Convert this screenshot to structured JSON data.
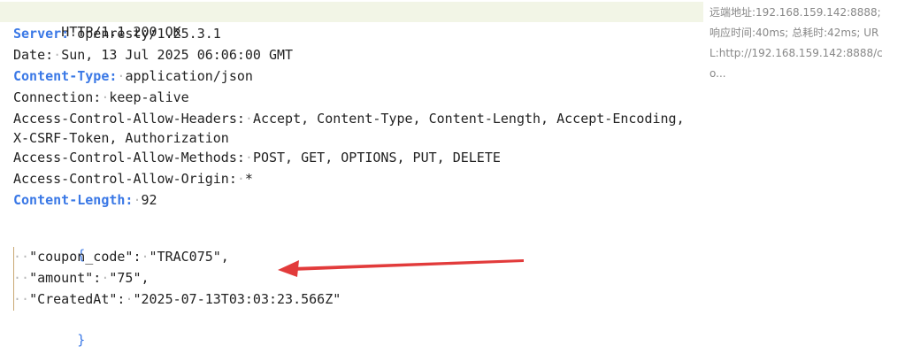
{
  "status_line": "HTTP/1.1 200 OK",
  "headers": [
    {
      "name": "Server:",
      "value": "openresty/1.25.3.1",
      "highlight": true
    },
    {
      "name": "Date:",
      "value": "Sun, 13 Jul 2025 06:06:00 GMT",
      "highlight": false
    },
    {
      "name": "Content-Type:",
      "value": "application/json",
      "highlight": true
    },
    {
      "name": "Connection:",
      "value": "keep-alive",
      "highlight": false
    },
    {
      "name": "Access-Control-Allow-Headers:",
      "value": "Accept, Content-Type, Content-Length, Accept-Encoding, X-CSRF-Token, Authorization",
      "highlight": false
    },
    {
      "name": "Access-Control-Allow-Methods:",
      "value": "POST, GET, OPTIONS, PUT, DELETE",
      "highlight": false
    },
    {
      "name": "Access-Control-Allow-Origin:",
      "value": "*",
      "highlight": false
    },
    {
      "name": "Content-Length:",
      "value": "92",
      "highlight": true
    }
  ],
  "body": {
    "open_brace": "{",
    "close_brace": "}",
    "fields": [
      {
        "key": "\"coupon_code\":",
        "value": "\"TRAC075\","
      },
      {
        "key": "\"amount\":",
        "value": "\"75\","
      },
      {
        "key": "\"CreatedAt\":",
        "value": "\"2025-07-13T03:03:23.566Z\""
      }
    ]
  },
  "meta": {
    "line1": "远端地址:192.168.159.142:8888;",
    "line2": "响应时间:40ms; 总耗时:42ms; UR",
    "line3": "L:http://192.168.159.142:8888/c",
    "line4": "o..."
  },
  "colors": {
    "header_highlight": "#3a78e6",
    "status_band": "#f2f5e6",
    "annotation_arrow": "#e23b3b"
  }
}
